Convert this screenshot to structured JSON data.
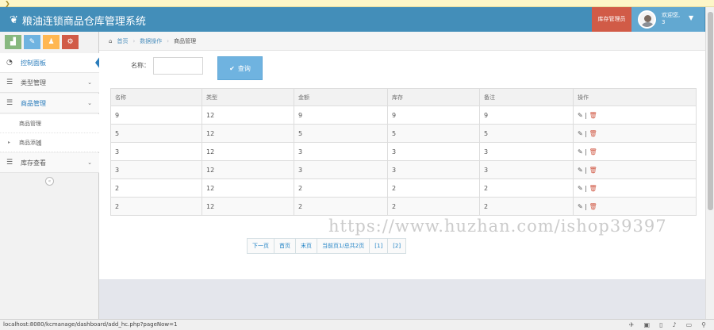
{
  "app": {
    "title": "粮油连锁商品仓库管理系统",
    "role_badge": "库存管理员",
    "welcome_line1": "欢迎您,",
    "welcome_line2": "3"
  },
  "sidebar": {
    "items": [
      {
        "label": "控制面板",
        "icon": "dashboard-icon"
      },
      {
        "label": "类型管理",
        "icon": "list-icon"
      },
      {
        "label": "商品管理",
        "icon": "list-icon"
      },
      {
        "label": "商品管理",
        "icon": "sub-item"
      },
      {
        "label": "商品添加",
        "icon": "sub-item"
      },
      {
        "label": "库存查看",
        "icon": "list-icon"
      }
    ]
  },
  "breadcrumb": {
    "home": "首页",
    "level2": "数据操作",
    "current": "商品管理"
  },
  "search": {
    "label": "名称：",
    "value": "",
    "button": "查询"
  },
  "table": {
    "headers": [
      "名称",
      "类型",
      "金额",
      "库存",
      "备注",
      "操作"
    ],
    "rows": [
      [
        "9",
        "12",
        "9",
        "9",
        "9"
      ],
      [
        "5",
        "12",
        "5",
        "5",
        "5"
      ],
      [
        "3",
        "12",
        "3",
        "3",
        "3"
      ],
      [
        "3",
        "12",
        "3",
        "3",
        "3"
      ],
      [
        "2",
        "12",
        "2",
        "2",
        "2"
      ],
      [
        "2",
        "12",
        "2",
        "2",
        "2"
      ]
    ],
    "op_separator": "|"
  },
  "pager": {
    "next": "下一页",
    "first": "首页",
    "last": "末页",
    "info": "当前页1/总共2页",
    "p1": "[1]",
    "p2": "[2]"
  },
  "status_url": "localhost:8080/kcmanage/dashboard/add_hc.php?pageNow=1",
  "watermark": "https://www.huzhan.com/ishop39397",
  "colors": {
    "topbar": "#438eb9",
    "role_badge": "#d15b47",
    "query_button": "#6fb3e0",
    "link": "#2283c5"
  }
}
